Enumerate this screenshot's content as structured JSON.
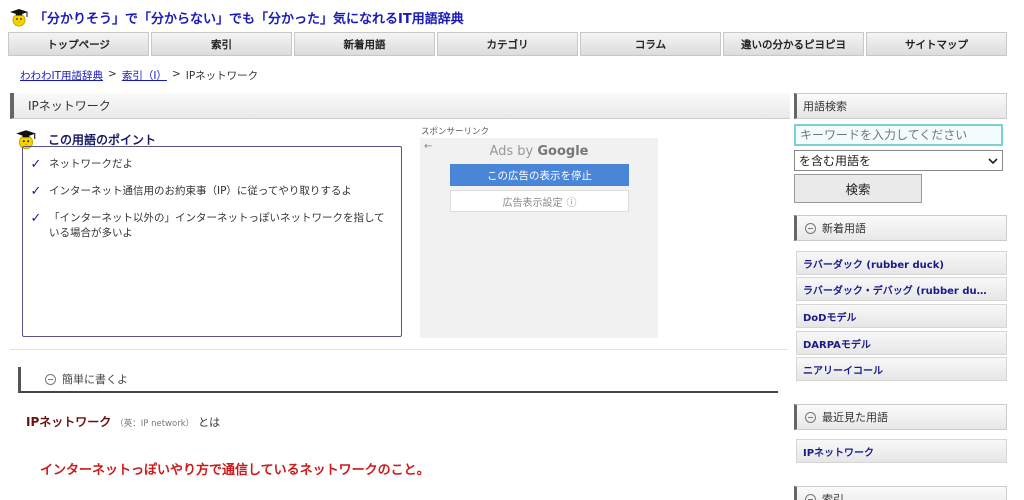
{
  "header": {
    "site_title": "「分かりそう」で「分からない」でも「分かった」気になれるIT用語辞典"
  },
  "nav": {
    "items": [
      {
        "label": "トップページ"
      },
      {
        "label": "索引"
      },
      {
        "label": "新着用語"
      },
      {
        "label": "カテゴリ"
      },
      {
        "label": "コラム"
      },
      {
        "label": "違いの分かるピヨピヨ"
      },
      {
        "label": "サイトマップ"
      }
    ]
  },
  "breadcrumb": {
    "home": "わわわIT用語辞典",
    "sep1": ">",
    "index": "索引（I）",
    "sep2": ">",
    "current": "IPネットワーク"
  },
  "page": {
    "title": "IPネットワーク"
  },
  "points": {
    "title": "この用語のポイント",
    "check": "✓",
    "items": [
      {
        "text": "ネットワークだよ"
      },
      {
        "text": "インターネット通信用のお約束事（IP）に従ってやり取りするよ"
      },
      {
        "text": "「インターネット以外の」インターネットっぽいネットワークを指している場合が多いよ"
      }
    ]
  },
  "ad": {
    "label": "スポンサーリンク",
    "back": "←",
    "ads_by": "Ads by",
    "google": "Google",
    "stop_button": "この広告の表示を停止",
    "settings_button": "広告表示設定",
    "info": "ⓘ"
  },
  "simple": {
    "label": "簡単に書くよ"
  },
  "term": {
    "name": "IPネットワーク",
    "english": "（英：IP network）",
    "toha": "とは"
  },
  "definition": {
    "text": "インターネットっぽいやり方で通信しているネットワークのこと。"
  },
  "sidebar": {
    "search_title": "用語検索",
    "search_placeholder": "キーワードを入力してください",
    "search_select": "を含む用語を",
    "search_button": "検索",
    "new_terms_title": "新着用語",
    "new_terms": [
      {
        "label": "ラバーダック (rubber duck)"
      },
      {
        "label": "ラバーダック・デバッグ (rubber du…"
      },
      {
        "label": "DoDモデル"
      },
      {
        "label": "DARPAモデル"
      },
      {
        "label": "ニアリーイコール"
      }
    ],
    "recent_title": "最近見た用語",
    "recent_terms": [
      {
        "label": "IPネットワーク"
      }
    ],
    "index_title": "索引"
  }
}
